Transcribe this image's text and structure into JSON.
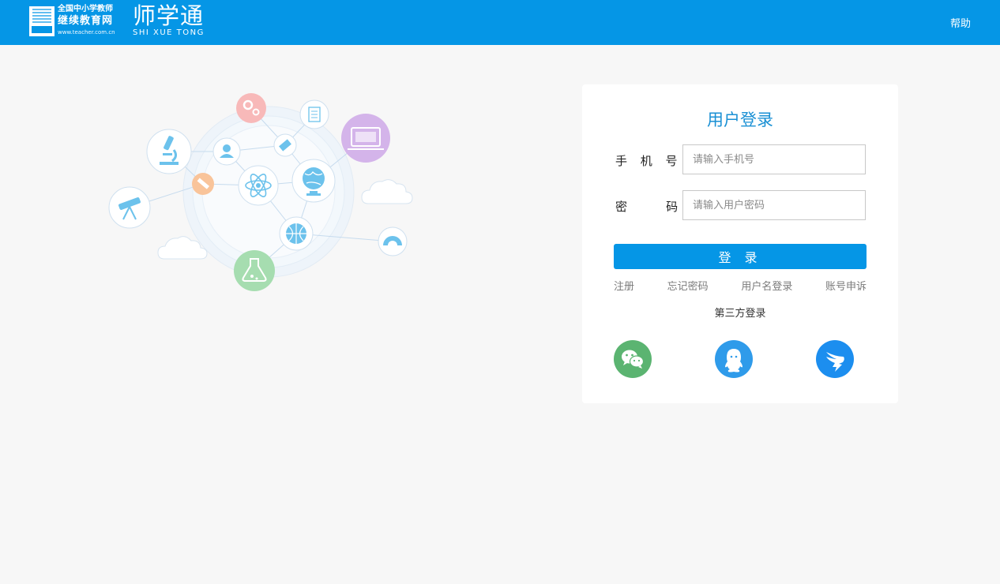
{
  "header": {
    "logo_line1": "全国中小学教师",
    "logo_line2": "继续教育网",
    "logo_line3": "www.teacher.com.cn",
    "brand_name": "师学通",
    "brand_subtitle": "SHI XUE TONG",
    "help_label": "帮助"
  },
  "login": {
    "title": "用户登录",
    "phone_label": "手 机 号:",
    "phone_placeholder": "请输入手机号",
    "phone_value": "",
    "password_label": "密    码:",
    "password_placeholder": "请输入用户密码",
    "password_value": "",
    "submit_label": "登 录",
    "links": [
      "注册",
      "忘记密码",
      "用户名登录",
      "账号申诉"
    ],
    "third_party_title": "第三方登录",
    "third_party": [
      "wechat-icon",
      "qq-icon",
      "dingtalk-icon"
    ]
  },
  "colors": {
    "header_bg": "#0596e6",
    "title": "#1a90d4",
    "button": "#0596e6",
    "wechat": "#5bb471",
    "qq": "#2f9bea",
    "dingtalk": "#1c8eef"
  }
}
